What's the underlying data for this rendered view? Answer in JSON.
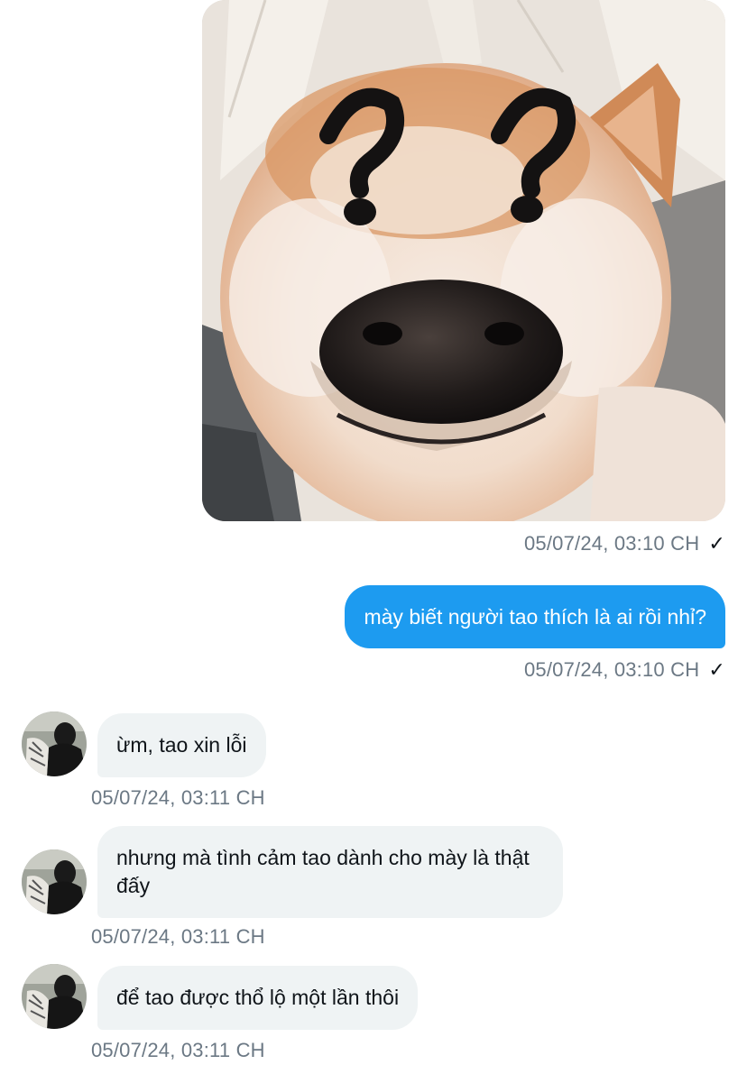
{
  "messages": {
    "image": {
      "timestamp": "05/07/24, 03:10 CH",
      "status": "✓"
    },
    "sent_text": {
      "text": "mày biết người tao thích là ai rồi nhỉ?",
      "timestamp": "05/07/24, 03:10 CH",
      "status": "✓"
    },
    "received": [
      {
        "text": "ừm, tao xin lỗi",
        "timestamp": "05/07/24, 03:11 CH"
      },
      {
        "text": "nhưng mà tình cảm tao dành cho mày là thật đấy",
        "timestamp": "05/07/24, 03:11 CH"
      },
      {
        "text": "để tao được thổ lộ một lần thôi",
        "timestamp": "05/07/24, 03:11 CH"
      }
    ]
  },
  "colors": {
    "sent_bubble": "#1d9bf0",
    "received_bubble": "#eff3f4",
    "timestamp": "#6b7884"
  },
  "icons": {
    "read_receipt": "checkmark-icon",
    "image_content": "shiba-dog-question-marks"
  }
}
